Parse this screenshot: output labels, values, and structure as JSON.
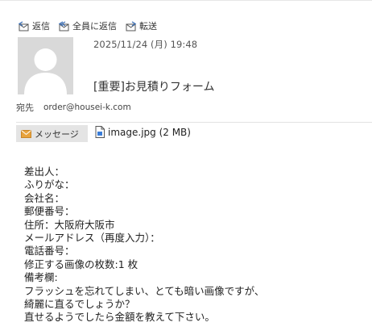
{
  "toolbar": {
    "reply_label": "返信",
    "reply_all_label": "全員に返信",
    "forward_label": "転送"
  },
  "header": {
    "date": "2025/11/24 (月) 19:48",
    "subject": "[重要]お見積りフォーム",
    "to_label": "宛先",
    "to_address": "order@housei-k.com"
  },
  "tabs": {
    "message_label": "メッセージ"
  },
  "attachment": {
    "label": "image.jpg (2 MB)"
  },
  "body": {
    "lines": [
      "差出人：",
      "ふりがな：",
      "会社名：",
      "郵便番号：",
      "住所：大阪府大阪市",
      "メールアドレス（再度入力）：",
      "電話番号：",
      "修正する画像の枚数:1 枚",
      "備考欄:",
      "フラッシュを忘れてしまい、とても暗い画像ですが、",
      "綺麗に直るでしょうか？",
      "直せるようでしたら金額を教えて下さい。"
    ]
  },
  "colors": {
    "envelope_icon": "#e8a33d",
    "file_icon": "#3b7dd8",
    "avatar_bg": "#d9d9d9"
  }
}
